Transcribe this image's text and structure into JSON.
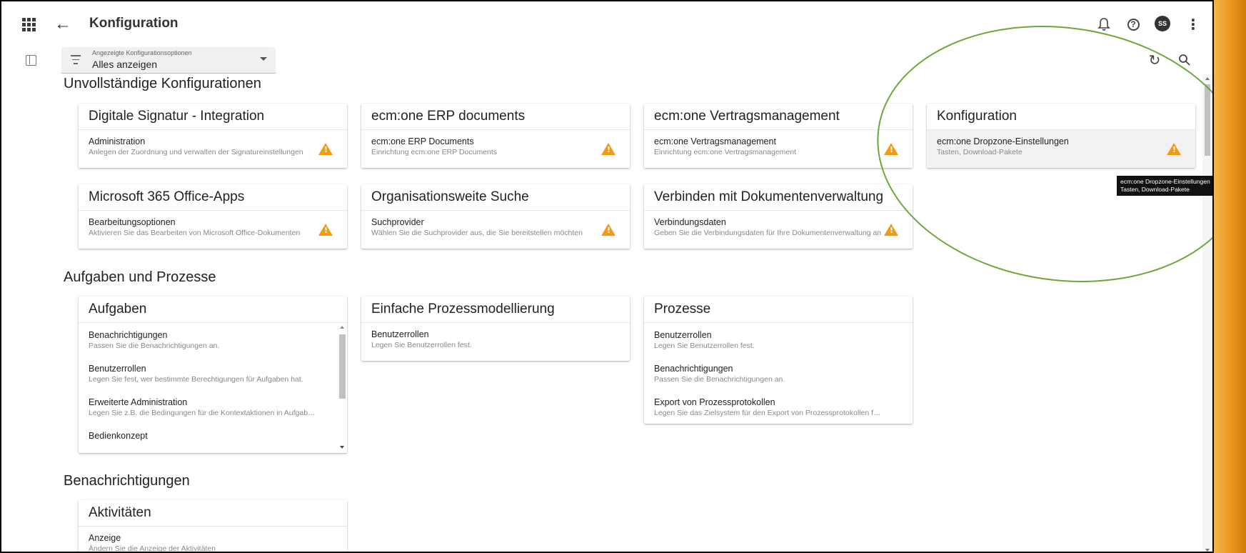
{
  "header": {
    "title": "Konfiguration",
    "avatar_initials": "SS"
  },
  "filter": {
    "label": "Angezeigte Konfigurationsoptionen",
    "value": "Alles anzeigen"
  },
  "sections": [
    {
      "title": "Unvollständige Konfigurationen",
      "cards": [
        {
          "title": "Digitale Signatur - Integration",
          "items": [
            {
              "name": "Administration",
              "desc": "Anlegen der Zuordnung und verwalten der Signatureinstellungen",
              "warning": true
            }
          ]
        },
        {
          "title": "ecm:one ERP documents",
          "items": [
            {
              "name": "ecm:one ERP Documents",
              "desc": "Einrichtung ecm:one ERP Documents",
              "warning": true
            }
          ]
        },
        {
          "title": "ecm:one Vertragsmanagement",
          "items": [
            {
              "name": "ecm:one Vertragsmanagement",
              "desc": "Einrichtung ecm:one Vertragsmanagement",
              "warning": true
            }
          ]
        },
        {
          "title": "Konfiguration",
          "items": [
            {
              "name": "ecm:one Dropzone-Einstellungen",
              "desc": "Tasten, Download-Pakete",
              "warning": true
            }
          ]
        },
        {
          "title": "Microsoft 365 Office-Apps",
          "items": [
            {
              "name": "Bearbeitungsoptionen",
              "desc": "Aktivieren Sie das Bearbeiten von Microsoft Office-Dokumenten",
              "warning": true
            }
          ]
        },
        {
          "title": "Organisationsweite Suche",
          "items": [
            {
              "name": "Suchprovider",
              "desc": "Wählen Sie die Suchprovider aus, die Sie bereitstellen möchten",
              "warning": true
            }
          ]
        },
        {
          "title": "Verbinden mit Dokumentenverwaltung",
          "items": [
            {
              "name": "Verbindungsdaten",
              "desc": "Geben Sie die Verbindungsdaten für Ihre Dokumentenverwaltung an",
              "warning": true
            }
          ]
        }
      ]
    },
    {
      "title": "Aufgaben und Prozesse",
      "cards": [
        {
          "title": "Aufgaben",
          "items": [
            {
              "name": "Benachrichtigungen",
              "desc": "Passen Sie die Benachrichtigungen an."
            },
            {
              "name": "Benutzerrollen",
              "desc": "Legen Sie fest, wer bestimmte Berechtigungen für Aufgaben hat."
            },
            {
              "name": "Erweiterte Administration",
              "desc": "Legen Sie z.B. die Bedingungen für die Kontextaktionen in Aufgaben fest."
            },
            {
              "name": "Bedienkonzept",
              "desc": ""
            }
          ]
        },
        {
          "title": "Einfache Prozessmodellierung",
          "items": [
            {
              "name": "Benutzerrollen",
              "desc": "Legen Sie Benutzerrollen fest."
            }
          ]
        },
        {
          "title": "Prozesse",
          "items": [
            {
              "name": "Benutzerrollen",
              "desc": "Legen Sie Benutzerrollen fest."
            },
            {
              "name": "Benachrichtigungen",
              "desc": "Passen Sie die Benachrichtigungen an."
            },
            {
              "name": "Export von Prozessprotokollen",
              "desc": "Legen Sie das Zielsystem für den Export von Prozessprotokollen fest."
            }
          ]
        }
      ]
    },
    {
      "title": "Benachrichtigungen",
      "cards": [
        {
          "title": "Aktivitäten",
          "items": [
            {
              "name": "Anzeige",
              "desc": "Ändern Sie die Anzeige der Aktivitäten"
            }
          ]
        }
      ]
    }
  ],
  "tooltip": {
    "line1": "ecm:one Dropzone-Einstellungen",
    "line2": "Tasten, Download-Pakete"
  },
  "colors": {
    "warning": "#f29a13",
    "annotation": "#6aa83a",
    "accent_strip": "#e8961c"
  }
}
